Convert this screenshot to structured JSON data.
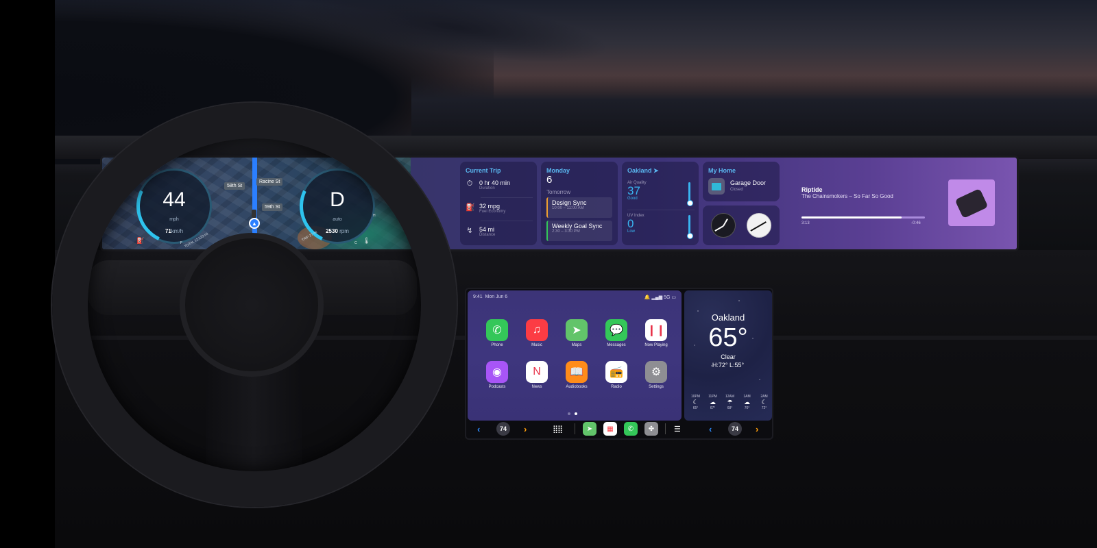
{
  "cluster": {
    "speed": "44",
    "speed_unit": "mph",
    "speed_kmh_value": "71",
    "speed_kmh_unit": "km/h",
    "odometer": "TOTAL 12,523 mi",
    "gear": "D",
    "gear_mode": "auto",
    "rpm_value": "2530",
    "rpm_unit": "rpm",
    "range": "TRIP 27 mi",
    "fuel_label": "F",
    "temp_label_c": "C",
    "temp_label_h": "H",
    "streets": [
      "58th St",
      "Racine St",
      "59th St"
    ]
  },
  "widgets": {
    "trip": {
      "title": "Current Trip",
      "rows": [
        {
          "icon": "stopwatch-icon",
          "value": "0 hr 40 min",
          "label": "Duration"
        },
        {
          "icon": "fuel-pump-icon",
          "value": "32 mpg",
          "label": "Fuel Economy"
        },
        {
          "icon": "route-icon",
          "value": "54 mi",
          "label": "Distance"
        }
      ]
    },
    "calendar": {
      "day": "Monday",
      "date": "6",
      "subtitle": "Tomorrow",
      "events": [
        {
          "title": "Design Sync",
          "time": "10:00 – 11:00 AM",
          "color": "#f0a030"
        },
        {
          "title": "Weekly Goal Sync",
          "time": "2:30 – 3:30 PM",
          "color": "#34c759"
        }
      ]
    },
    "weather": {
      "city": "Oakland",
      "aq_label": "Air Quality",
      "aq_value": "37",
      "aq_desc": "Good",
      "uv_label": "UV Index",
      "uv_value": "0",
      "uv_desc": "Low"
    },
    "home": {
      "title": "My Home",
      "device": "Garage Door",
      "state": "Closed"
    },
    "now_playing": {
      "title": "Riptide",
      "artist_album": "The Chainsmokers – So Far So Good",
      "elapsed": "3:13",
      "remaining": "-0:46",
      "progress": 0.81
    }
  },
  "carplay": {
    "time": "9:41",
    "date": "Mon Jun 6",
    "signal": "5G",
    "apps": [
      {
        "label": "Phone",
        "icon": "phone-icon",
        "color": "#34c759",
        "glyph": "✆"
      },
      {
        "label": "Music",
        "icon": "music-icon",
        "color": "#fc3c44",
        "glyph": "♫"
      },
      {
        "label": "Maps",
        "icon": "maps-icon",
        "color": "#62c46a",
        "glyph": "➤"
      },
      {
        "label": "Messages",
        "icon": "messages-icon",
        "color": "#34c759",
        "glyph": "💬"
      },
      {
        "label": "Now Playing",
        "icon": "now-playing-icon",
        "color": "#ffffff",
        "glyph": "❙❙"
      },
      {
        "label": "Podcasts",
        "icon": "podcasts-icon",
        "color": "#a855f7",
        "glyph": "◉"
      },
      {
        "label": "News",
        "icon": "news-icon",
        "color": "#ffffff",
        "glyph": "N"
      },
      {
        "label": "Audiobooks",
        "icon": "audiobooks-icon",
        "color": "#ff8c1a",
        "glyph": "📖"
      },
      {
        "label": "Radio",
        "icon": "radio-icon",
        "color": "#ffffff",
        "glyph": "📻"
      },
      {
        "label": "Settings",
        "icon": "settings-icon",
        "color": "#8e8e93",
        "glyph": "⚙"
      }
    ],
    "page_count": 2,
    "current_page": 2,
    "climate_left": "74",
    "climate_right": "74",
    "weather": {
      "city": "Oakland",
      "temp": "65°",
      "condition": "Clear",
      "high_low": "H:72°  L:55°",
      "hourly": [
        {
          "time": "10PM",
          "icon": "moon-icon",
          "glyph": "☾",
          "temp": "65°"
        },
        {
          "time": "11PM",
          "icon": "cloud-rain-icon",
          "glyph": "☁",
          "temp": "67°"
        },
        {
          "time": "12AM",
          "icon": "cloud-rain-icon",
          "glyph": "☂",
          "temp": "68°"
        },
        {
          "time": "1AM",
          "icon": "cloud-moon-icon",
          "glyph": "☁",
          "temp": "70°"
        },
        {
          "time": "2AM",
          "icon": "moon-icon",
          "glyph": "☾",
          "temp": "72°"
        }
      ]
    }
  }
}
